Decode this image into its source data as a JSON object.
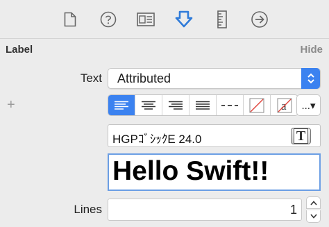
{
  "toolbar": {
    "items": [
      {
        "icon": "file-inspector-icon"
      },
      {
        "icon": "quick-help-icon"
      },
      {
        "icon": "identity-inspector-icon"
      },
      {
        "icon": "attributes-inspector-icon",
        "active": true
      },
      {
        "icon": "size-inspector-icon"
      },
      {
        "icon": "connections-inspector-icon"
      }
    ],
    "accent": "#2f7bd9"
  },
  "section": {
    "title": "Label",
    "hide_label": "Hide"
  },
  "text_row": {
    "label": "Text",
    "value": "Attributed"
  },
  "plus_label": "+",
  "alignment": {
    "options": [
      "align-left-icon",
      "align-center-icon",
      "align-right-icon",
      "align-justify-icon",
      "align-natural-icon",
      "background-color-icon",
      "foreground-color-icon"
    ],
    "selected": 0,
    "more_label": "...▾"
  },
  "font": {
    "value": "HGPｺﾞｼｯｸE 24.0",
    "button_label": "T"
  },
  "text_content": "Hello Swift!!",
  "lines_row": {
    "label": "Lines",
    "value": "1"
  }
}
